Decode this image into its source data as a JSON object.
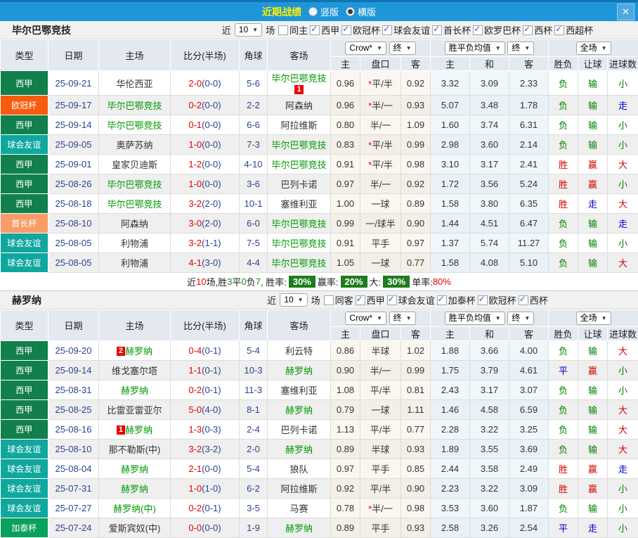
{
  "topbar": {
    "title": "近期战绩",
    "vertical": "竖版",
    "horizontal": "横版",
    "close": "✕"
  },
  "table_header": {
    "cols": [
      "类型",
      "日期",
      "主场",
      "比分(半场)",
      "角球",
      "客场"
    ],
    "odds_company": "Crow*",
    "final_label": "终",
    "avg_label": "胜平负均值",
    "scope_label": "全场",
    "sub": [
      "主",
      "盘口",
      "客",
      "主",
      "和",
      "客",
      "胜负",
      "让球",
      "进球数"
    ]
  },
  "filters_common": {
    "near": "近",
    "count": "10",
    "games": "场"
  },
  "colors": {
    "bar": "#1E96DA",
    "title": "#FFF000",
    "league": {
      "西甲": "#12804C",
      "欧冠杯": "#F95B0D",
      "球会友谊": "#10A79E",
      "首长杯": "#F99C68",
      "加泰杯": "#0AA05D"
    },
    "result": {
      "胜": "#D70000",
      "赢": "#D70000",
      "大": "#D70000",
      "负": "#008000",
      "输": "#008000",
      "小": "#008000",
      "平": "#0000D0",
      "走": "#0000D0"
    },
    "team_green": "#009900",
    "score_red": "#E60000",
    "navy": "#2B4490",
    "summary_badge": "#1E7D1E",
    "red_badge": "#E80000"
  },
  "sections": [
    {
      "team": "毕尔巴鄂竞技",
      "same_label": "同主",
      "same_checked": false,
      "leagues": [
        "西甲",
        "欧冠杯",
        "球会友谊",
        "首长杯",
        "欧罗巴杯",
        "西杯",
        "西超杯"
      ],
      "rows": [
        {
          "lg": "西甲",
          "date": "25-09-21",
          "home": "华伦西亚",
          "home_green": false,
          "score": "2-0",
          "half": "(0-0)",
          "corner": "5-6",
          "away": "毕尔巴鄂竞技",
          "away_green": true,
          "away_badge": "1",
          "odds": [
            "0.96",
            "*平/半",
            "0.92"
          ],
          "avg": [
            "3.32",
            "3.09",
            "2.33"
          ],
          "res": [
            "负",
            "输",
            "小"
          ]
        },
        {
          "lg": "欧冠杯",
          "date": "25-09-17",
          "home": "毕尔巴鄂竞技",
          "home_green": true,
          "score": "0-2",
          "half": "(0-0)",
          "corner": "2-2",
          "away": "阿森纳",
          "away_green": false,
          "odds": [
            "0.96",
            "*半/一",
            "0.93"
          ],
          "avg": [
            "5.07",
            "3.48",
            "1.78"
          ],
          "res": [
            "负",
            "输",
            "走"
          ]
        },
        {
          "lg": "西甲",
          "date": "25-09-14",
          "home": "毕尔巴鄂竞技",
          "home_green": true,
          "score": "0-1",
          "half": "(0-0)",
          "corner": "6-6",
          "away": "阿拉维斯",
          "away_green": false,
          "odds": [
            "0.80",
            "半/一",
            "1.09"
          ],
          "avg": [
            "1.60",
            "3.74",
            "6.31"
          ],
          "res": [
            "负",
            "输",
            "小"
          ]
        },
        {
          "lg": "球会友谊",
          "date": "25-09-05",
          "home": "奥萨苏纳",
          "home_green": false,
          "score": "1-0",
          "half": "(0-0)",
          "corner": "7-3",
          "away": "毕尔巴鄂竞技",
          "away_green": true,
          "odds": [
            "0.83",
            "*平/半",
            "0.99"
          ],
          "avg": [
            "2.98",
            "3.60",
            "2.14"
          ],
          "res": [
            "负",
            "输",
            "小"
          ]
        },
        {
          "lg": "西甲",
          "date": "25-09-01",
          "home": "皇家贝迪斯",
          "home_green": false,
          "score": "1-2",
          "half": "(0-0)",
          "corner": "4-10",
          "away": "毕尔巴鄂竞技",
          "away_green": true,
          "odds": [
            "0.91",
            "*平/半",
            "0.98"
          ],
          "avg": [
            "3.10",
            "3.17",
            "2.41"
          ],
          "res": [
            "胜",
            "赢",
            "大"
          ]
        },
        {
          "lg": "西甲",
          "date": "25-08-26",
          "home": "毕尔巴鄂竞技",
          "home_green": true,
          "score": "1-0",
          "half": "(0-0)",
          "corner": "3-6",
          "away": "巴列卡诺",
          "away_green": false,
          "odds": [
            "0.97",
            "半/一",
            "0.92"
          ],
          "avg": [
            "1.72",
            "3.56",
            "5.24"
          ],
          "res": [
            "胜",
            "赢",
            "小"
          ]
        },
        {
          "lg": "西甲",
          "date": "25-08-18",
          "home": "毕尔巴鄂竞技",
          "home_green": true,
          "score": "3-2",
          "half": "(2-0)",
          "corner": "10-1",
          "away": "塞维利亚",
          "away_green": false,
          "odds": [
            "1.00",
            "一球",
            "0.89"
          ],
          "avg": [
            "1.58",
            "3.80",
            "6.35"
          ],
          "res": [
            "胜",
            "走",
            "大"
          ]
        },
        {
          "lg": "首长杯",
          "date": "25-08-10",
          "home": "阿森纳",
          "home_green": false,
          "score": "3-0",
          "half": "(2-0)",
          "corner": "6-0",
          "away": "毕尔巴鄂竞技",
          "away_green": true,
          "odds": [
            "0.99",
            "一/球半",
            "0.90"
          ],
          "avg": [
            "1.44",
            "4.51",
            "6.47"
          ],
          "res": [
            "负",
            "输",
            "走"
          ]
        },
        {
          "lg": "球会友谊",
          "date": "25-08-05",
          "home": "利物浦",
          "home_green": false,
          "score": "3-2",
          "half": "(1-1)",
          "corner": "7-5",
          "away": "毕尔巴鄂竞技",
          "away_green": true,
          "odds": [
            "0.91",
            "平手",
            "0.97"
          ],
          "avg": [
            "1.37",
            "5.74",
            "11.27"
          ],
          "res": [
            "负",
            "输",
            "小"
          ]
        },
        {
          "lg": "球会友谊",
          "date": "25-08-05",
          "home": "利物浦",
          "home_green": false,
          "score": "4-1",
          "half": "(3-0)",
          "corner": "4-4",
          "away": "毕尔巴鄂竞技",
          "away_green": true,
          "odds": [
            "1.05",
            "一球",
            "0.77"
          ],
          "avg": [
            "1.58",
            "4.08",
            "5.10"
          ],
          "res": [
            "负",
            "输",
            "大"
          ]
        }
      ],
      "summary_parts": [
        [
          "t",
          "近"
        ],
        [
          "r",
          "10"
        ],
        [
          "t",
          "场,胜"
        ],
        [
          "g",
          "3"
        ],
        [
          "t",
          "平"
        ],
        [
          "g",
          "0"
        ],
        [
          "t",
          "负"
        ],
        [
          "g",
          "7"
        ],
        [
          "t",
          ", 胜率:"
        ],
        [
          "b",
          "30%"
        ],
        [
          "t",
          " 赢率:"
        ],
        [
          "b",
          "20%"
        ],
        [
          "t",
          " 大:"
        ],
        [
          "b",
          "30%"
        ],
        [
          "t",
          " 单率:"
        ],
        [
          "r",
          "80%"
        ]
      ]
    },
    {
      "team": "赫罗纳",
      "same_label": "同客",
      "same_checked": false,
      "leagues": [
        "西甲",
        "球会友谊",
        "加泰杯",
        "欧冠杯",
        "西杯"
      ],
      "rows": [
        {
          "lg": "西甲",
          "date": "25-09-20",
          "home": "赫罗纳",
          "home_green": true,
          "home_badge": "2",
          "score": "0-4",
          "half": "(0-1)",
          "corner": "5-4",
          "away": "利云特",
          "away_green": false,
          "odds": [
            "0.86",
            "半球",
            "1.02"
          ],
          "avg": [
            "1.88",
            "3.66",
            "4.00"
          ],
          "res": [
            "负",
            "输",
            "大"
          ]
        },
        {
          "lg": "西甲",
          "date": "25-09-14",
          "home": "维戈塞尔塔",
          "home_green": false,
          "score": "1-1",
          "half": "(0-1)",
          "corner": "10-3",
          "away": "赫罗纳",
          "away_green": true,
          "odds": [
            "0.90",
            "半/一",
            "0.99"
          ],
          "avg": [
            "1.75",
            "3.79",
            "4.61"
          ],
          "res": [
            "平",
            "赢",
            "小"
          ]
        },
        {
          "lg": "西甲",
          "date": "25-08-31",
          "home": "赫罗纳",
          "home_green": true,
          "score": "0-2",
          "half": "(0-1)",
          "corner": "11-3",
          "away": "塞维利亚",
          "away_green": false,
          "odds": [
            "1.08",
            "平/半",
            "0.81"
          ],
          "avg": [
            "2.43",
            "3.17",
            "3.07"
          ],
          "res": [
            "负",
            "输",
            "小"
          ]
        },
        {
          "lg": "西甲",
          "date": "25-08-25",
          "home": "比雷亚雷亚尔",
          "home_green": false,
          "score": "5-0",
          "half": "(4-0)",
          "corner": "8-1",
          "away": "赫罗纳",
          "away_green": true,
          "odds": [
            "0.79",
            "一球",
            "1.11"
          ],
          "avg": [
            "1.46",
            "4.58",
            "6.59"
          ],
          "res": [
            "负",
            "输",
            "大"
          ]
        },
        {
          "lg": "西甲",
          "date": "25-08-16",
          "home": "赫罗纳",
          "home_green": true,
          "home_badge": "1",
          "score": "1-3",
          "half": "(0-3)",
          "corner": "2-4",
          "away": "巴列卡诺",
          "away_green": false,
          "odds": [
            "1.13",
            "平/半",
            "0.77"
          ],
          "avg": [
            "2.28",
            "3.22",
            "3.25"
          ],
          "res": [
            "负",
            "输",
            "大"
          ]
        },
        {
          "lg": "球会友谊",
          "date": "25-08-10",
          "home": "那不勒斯(中)",
          "home_green": false,
          "score": "3-2",
          "half": "(3-2)",
          "corner": "2-0",
          "away": "赫罗纳",
          "away_green": true,
          "odds": [
            "0.89",
            "半球",
            "0.93"
          ],
          "avg": [
            "1.89",
            "3.55",
            "3.69"
          ],
          "res": [
            "负",
            "输",
            "大"
          ]
        },
        {
          "lg": "球会友谊",
          "date": "25-08-04",
          "home": "赫罗纳",
          "home_green": true,
          "score": "2-1",
          "half": "(0-0)",
          "corner": "5-4",
          "away": "狼队",
          "away_green": false,
          "odds": [
            "0.97",
            "平手",
            "0.85"
          ],
          "avg": [
            "2.44",
            "3.58",
            "2.49"
          ],
          "res": [
            "胜",
            "赢",
            "走"
          ]
        },
        {
          "lg": "球会友谊",
          "date": "25-07-31",
          "home": "赫罗纳",
          "home_green": true,
          "score": "1-0",
          "half": "(1-0)",
          "corner": "6-2",
          "away": "阿拉维斯",
          "away_green": false,
          "odds": [
            "0.92",
            "平/半",
            "0.90"
          ],
          "avg": [
            "2.23",
            "3.22",
            "3.09"
          ],
          "res": [
            "胜",
            "赢",
            "小"
          ]
        },
        {
          "lg": "球会友谊",
          "date": "25-07-27",
          "home": "赫罗纳(中)",
          "home_green": true,
          "score": "0-2",
          "half": "(0-1)",
          "corner": "3-5",
          "away": "马赛",
          "away_green": false,
          "odds": [
            "0.78",
            "*半/一",
            "0.98"
          ],
          "avg": [
            "3.53",
            "3.60",
            "1.87"
          ],
          "res": [
            "负",
            "输",
            "小"
          ]
        },
        {
          "lg": "加泰杯",
          "date": "25-07-24",
          "home": "爱斯宾奴(中)",
          "home_green": false,
          "score": "0-0",
          "half": "(0-0)",
          "corner": "1-9",
          "away": "赫罗纳",
          "away_green": true,
          "odds": [
            "0.89",
            "平手",
            "0.93"
          ],
          "avg": [
            "2.58",
            "3.26",
            "2.54"
          ],
          "res": [
            "平",
            "走",
            "小"
          ]
        }
      ]
    }
  ]
}
